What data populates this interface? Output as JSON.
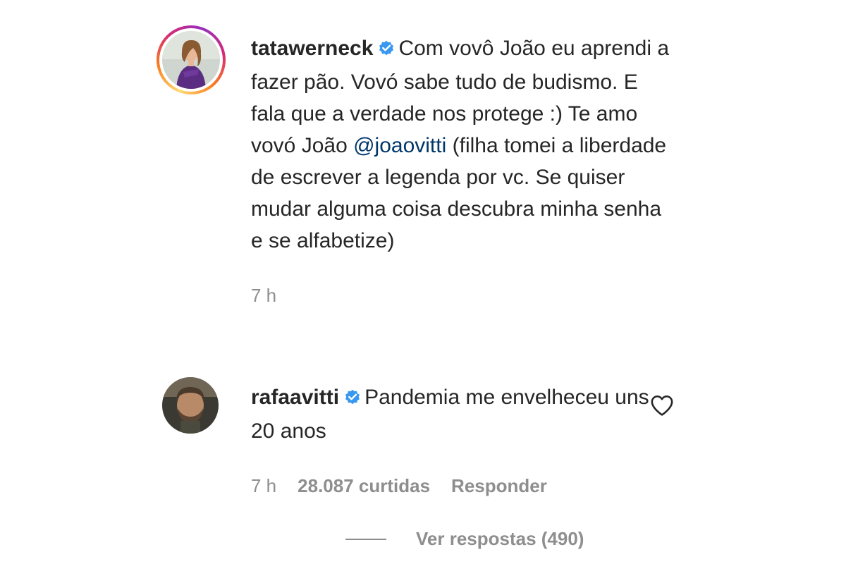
{
  "comments": [
    {
      "username": "tatawerneck",
      "verified": true,
      "text_before_mention": "Com vovô João eu aprendi a fazer pão. Vovó sabe tudo de budismo. E fala que a verdade nos protege :) Te amo vovó João ",
      "mention": "@joaovitti",
      "text_after_mention": " (filha tomei a liberdade de escrever a legenda por vc. Se quiser mudar alguma coisa descubra minha senha e se alfabetize)",
      "time": "7 h",
      "avatar_icon": "avatar-photo-woman-purple-top",
      "story_ring": true
    },
    {
      "username": "rafaavitti",
      "verified": true,
      "text": "Pandemia me envelheceu uns 20 anos",
      "time": "7 h",
      "likes": "28.087 curtidas",
      "reply_label": "Responder",
      "view_replies": "Ver respostas (490)",
      "like_icon": "heart-outline-icon",
      "avatar_icon": "avatar-photo-man-beard"
    }
  ],
  "colors": {
    "text": "#262626",
    "muted": "#8e8e8e",
    "mention": "#00376b",
    "verified_badge": "#3897f0"
  }
}
